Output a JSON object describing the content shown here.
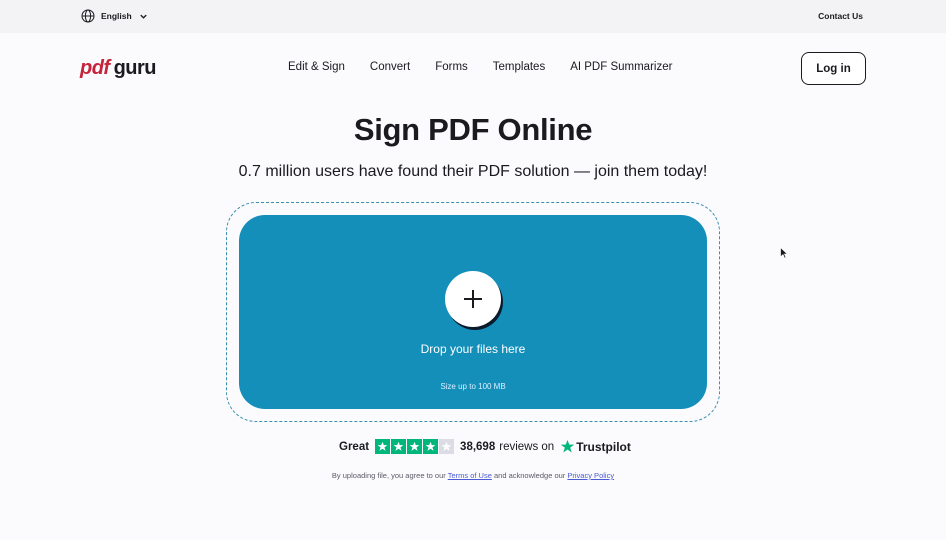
{
  "topbar": {
    "language_label": "English",
    "contact_label": "Contact Us"
  },
  "header": {
    "logo_pdf": "pdf",
    "logo_guru": "guru",
    "nav": [
      {
        "label": "Edit & Sign"
      },
      {
        "label": "Convert"
      },
      {
        "label": "Forms"
      },
      {
        "label": "Templates"
      },
      {
        "label": "AI PDF Summarizer"
      }
    ],
    "login_label": "Log in"
  },
  "hero": {
    "title": "Sign PDF Online",
    "subtitle": "0.7 million users have found their PDF solution — join them today!"
  },
  "dropzone": {
    "prompt": "Drop your files here",
    "size_limit": "Size up to 100 MB",
    "icon": "plus-icon"
  },
  "rating": {
    "label": "Great",
    "stars_filled": 4,
    "stars_total": 5,
    "count_text": "38,698",
    "reviews_text": "reviews on",
    "provider": "Trustpilot",
    "star_color": "#00b67a"
  },
  "legal": {
    "prefix": "By uploading file, you agree to our",
    "terms": "Terms of Use",
    "middle": "and acknowledge our",
    "privacy": "Privacy Policy"
  },
  "colors": {
    "accent": "#138fba",
    "brand_red": "#c5243a",
    "background": "#fbfafd"
  }
}
